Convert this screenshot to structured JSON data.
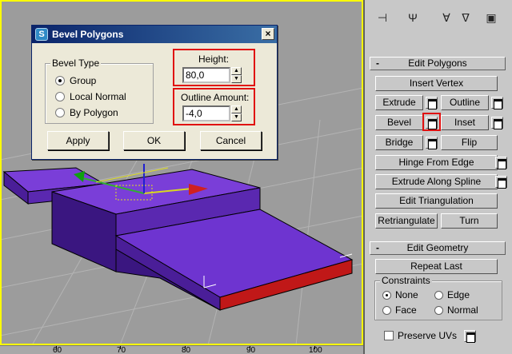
{
  "dialog": {
    "title": "Bevel Polygons",
    "title_icon": "S",
    "close_glyph": "×",
    "bevel_type": {
      "title": "Bevel Type",
      "options": [
        "Group",
        "Local Normal",
        "By Polygon"
      ],
      "selected": "Group"
    },
    "height": {
      "label": "Height:",
      "value": "80,0"
    },
    "outline": {
      "label": "Outline Amount:",
      "value": "-4,0"
    },
    "buttons": {
      "apply": "Apply",
      "ok": "OK",
      "cancel": "Cancel"
    }
  },
  "viewport": {
    "ruler_labels": [
      "60",
      "70",
      "80",
      "90",
      "100"
    ],
    "border_color": "#ffff00",
    "object_color": "#6a2ec8",
    "selected_face_color": "#c01818"
  },
  "panel": {
    "tab_icons": [
      "pin-icon",
      "fork-icon",
      "funnel-icon",
      "modifier-icon"
    ],
    "edit_polygons": {
      "title": "Edit Polygons",
      "collapse": "-",
      "insert_vertex": "Insert Vertex",
      "extrude": "Extrude",
      "outline": "Outline",
      "bevel": "Bevel",
      "inset": "Inset",
      "bridge": "Bridge",
      "flip": "Flip",
      "hinge_from_edge": "Hinge From Edge",
      "extrude_along_spline": "Extrude Along Spline",
      "edit_triangulation": "Edit Triangulation",
      "retriangulate": "Retriangulate",
      "turn": "Turn"
    },
    "edit_geometry": {
      "title": "Edit Geometry",
      "collapse": "-",
      "repeat_last": "Repeat Last",
      "constraints": {
        "title": "Constraints",
        "none": "None",
        "edge": "Edge",
        "face": "Face",
        "normal": "Normal",
        "selected": "None"
      },
      "preserve_uvs": "Preserve UVs"
    }
  },
  "colors": {
    "highlight": "#e01010",
    "title_bar": "#0a246a"
  }
}
